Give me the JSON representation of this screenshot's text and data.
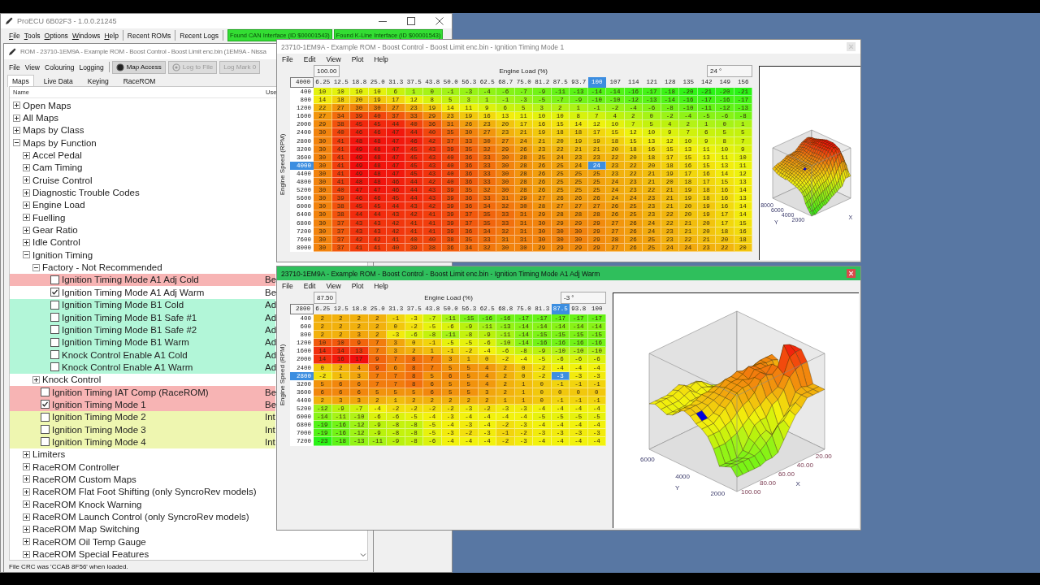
{
  "app_window": {
    "title": "ProECU 6B02F3 - 1.0.0.21245",
    "menu": [
      "File",
      "Tools",
      "Options",
      "Windows",
      "Help"
    ],
    "toolbar_buttons": [
      "Recent ROMs",
      "Recent Logs"
    ],
    "status_badges": [
      "Found CAN Interface (ID $00001543)",
      "Found K-Line Interface (ID $00001543)"
    ]
  },
  "rom_window": {
    "title": "ROM - 23710-1EM9A - Example ROM - Boost Control - Boost Limit enc.bin (1EM9A - Nissa",
    "menu": [
      "File",
      "View",
      "Colouring",
      "Logging"
    ],
    "toolbar_buttons": [
      {
        "label": "Map Access",
        "disabled": false
      },
      {
        "label": "Log to File",
        "disabled": true
      },
      {
        "label": "Log Mark 0",
        "disabled": true
      }
    ],
    "tabs": [
      {
        "label": "Maps",
        "selected": true
      },
      {
        "label": "Live Data",
        "selected": false
      },
      {
        "label": "Keying",
        "selected": false
      },
      {
        "label": "RaceROM",
        "selected": false
      }
    ],
    "tree": {
      "columns": [
        "Name",
        "Use"
      ],
      "items": [
        {
          "kind": "folder",
          "label": "Open Maps",
          "expanded": false
        },
        {
          "kind": "folder",
          "label": "All Maps",
          "expanded": false
        },
        {
          "kind": "folder",
          "label": "Maps by Class",
          "expanded": false
        },
        {
          "kind": "folder",
          "label": "Maps by Function",
          "expanded": true,
          "children": [
            {
              "kind": "folder",
              "label": "Accel Pedal",
              "expanded": false
            },
            {
              "kind": "folder",
              "label": "Cam Timing",
              "expanded": false
            },
            {
              "kind": "folder",
              "label": "Cruise Control",
              "expanded": false
            },
            {
              "kind": "folder",
              "label": "Diagnostic Trouble Codes",
              "expanded": false
            },
            {
              "kind": "folder",
              "label": "Engine Load",
              "expanded": false
            },
            {
              "kind": "folder",
              "label": "Fuelling",
              "expanded": false
            },
            {
              "kind": "folder",
              "label": "Gear Ratio",
              "expanded": false
            },
            {
              "kind": "folder",
              "label": "Idle Control",
              "expanded": false
            },
            {
              "kind": "folder",
              "label": "Ignition Timing",
              "expanded": true,
              "children": [
                {
                  "kind": "folder",
                  "label": "Factory - Not Recommended",
                  "expanded": true,
                  "children": [
                    {
                      "kind": "map",
                      "label": "Ignition Timing Mode A1 Adj Cold",
                      "checked": false,
                      "color": "#f7b4b4",
                      "user": "Be"
                    },
                    {
                      "kind": "map",
                      "label": "Ignition Timing Mode A1 Adj Warm",
                      "checked": true,
                      "user": "Be"
                    },
                    {
                      "kind": "map",
                      "label": "Ignition Timing Mode B1 Cold",
                      "checked": false,
                      "color": "#b2f6d8",
                      "user": "Ad"
                    },
                    {
                      "kind": "map",
                      "label": "Ignition Timing Mode B1 Safe #1",
                      "checked": false,
                      "color": "#b2f6d8",
                      "user": "Ad"
                    },
                    {
                      "kind": "map",
                      "label": "Ignition Timing Mode B1 Safe #2",
                      "checked": false,
                      "color": "#b2f6d8",
                      "user": "Ad"
                    },
                    {
                      "kind": "map",
                      "label": "Ignition Timing Mode B1 Warm",
                      "checked": false,
                      "color": "#b2f6d8",
                      "user": "Ad"
                    },
                    {
                      "kind": "map",
                      "label": "Knock Control Enable A1 Cold",
                      "checked": false,
                      "color": "#b2f6d8",
                      "user": "Ad"
                    },
                    {
                      "kind": "map",
                      "label": "Knock Control Enable A1 Warm",
                      "checked": false,
                      "color": "#b2f6d8",
                      "user": "Ad"
                    }
                  ]
                },
                {
                  "kind": "folder",
                  "label": "Knock Control",
                  "expanded": false
                },
                {
                  "kind": "map",
                  "label": "Ignition Timing IAT Comp (RaceROM)",
                  "checked": false,
                  "color": "#f7b4b4",
                  "user": "Be"
                },
                {
                  "kind": "map",
                  "label": "Ignition Timing Mode 1",
                  "checked": true,
                  "color": "#f7b4b4",
                  "user": "Be"
                },
                {
                  "kind": "map",
                  "label": "Ignition Timing Mode 2",
                  "checked": false,
                  "color": "#eef6b0",
                  "user": "Int"
                },
                {
                  "kind": "map",
                  "label": "Ignition Timing Mode 3",
                  "checked": false,
                  "color": "#eef6b0",
                  "user": "Int"
                },
                {
                  "kind": "map",
                  "label": "Ignition Timing Mode 4",
                  "checked": false,
                  "color": "#eef6b0",
                  "user": "Int"
                }
              ]
            },
            {
              "kind": "folder",
              "label": "Limiters",
              "expanded": false
            },
            {
              "kind": "folder",
              "label": "RaceROM Controller",
              "expanded": false
            },
            {
              "kind": "folder",
              "label": "RaceROM Custom Maps",
              "expanded": false
            },
            {
              "kind": "folder",
              "label": "RaceROM Flat Foot Shifting (only SyncroRev models)",
              "expanded": false
            },
            {
              "kind": "folder",
              "label": "RaceROM Knock Warning",
              "expanded": false
            },
            {
              "kind": "folder",
              "label": "RaceROM Launch Control (only SyncroRev models)",
              "expanded": false
            },
            {
              "kind": "folder",
              "label": "RaceROM Map Switching",
              "expanded": false
            },
            {
              "kind": "folder",
              "label": "RaceROM Oil Temp Gauge",
              "expanded": false
            },
            {
              "kind": "folder",
              "label": "RaceROM Special Features",
              "expanded": false
            }
          ]
        }
      ]
    },
    "status_bar": "File CRC was 'CCAB 8F56' when loaded."
  },
  "map_windows": [
    {
      "title": "23710-1EM9A - Example ROM - Boost Control - Boost Limit enc.bin - Ignition Timing Mode 1",
      "active": false,
      "menu": [
        "File",
        "Edit",
        "View",
        "Plot",
        "Help"
      ],
      "x_value": "100.00",
      "axis_title": "Engine Load (%)",
      "cell_value": "24 °",
      "corner": "4000",
      "y_axis_title": "Engine Speed (RPM)",
      "columns": [
        {
          "label": "6.25",
          "selected": false
        },
        {
          "label": "12.5",
          "selected": false
        },
        {
          "label": "18.8",
          "selected": false
        },
        {
          "label": "25.0",
          "selected": false
        },
        {
          "label": "31.3",
          "selected": false
        },
        {
          "label": "37.5",
          "selected": false
        },
        {
          "label": "43.8",
          "selected": false
        },
        {
          "label": "50.0",
          "selected": false
        },
        {
          "label": "56.3",
          "selected": false
        },
        {
          "label": "62.5",
          "selected": false
        },
        {
          "label": "68.7",
          "selected": false
        },
        {
          "label": "75.0",
          "selected": false
        },
        {
          "label": "81.2",
          "selected": false
        },
        {
          "label": "87.5",
          "selected": false
        },
        {
          "label": "93.7",
          "selected": false
        },
        {
          "label": "100",
          "selected": true
        },
        {
          "label": "107",
          "selected": false
        },
        {
          "label": "114",
          "selected": false
        },
        {
          "label": "121",
          "selected": false
        },
        {
          "label": "128",
          "selected": false
        },
        {
          "label": "135",
          "selected": false
        },
        {
          "label": "142",
          "selected": false
        },
        {
          "label": "149",
          "selected": false
        },
        {
          "label": "156",
          "selected": false
        }
      ],
      "rows": [
        {
          "label": "400",
          "selected": false,
          "cells": [
            "10",
            "10",
            "10",
            "10",
            "6",
            "1",
            "0",
            "-1",
            "-3",
            "-4",
            "-6",
            "-7",
            "-9",
            "-11",
            "-13",
            "-14",
            "-14",
            "-16",
            "-17",
            "-18",
            "-20",
            "-21",
            "-20",
            "-21"
          ]
        },
        {
          "label": "800",
          "selected": false,
          "cells": [
            "14",
            "18",
            "20",
            "19",
            "17",
            "12",
            "8",
            "5",
            "3",
            "1",
            "-1",
            "-3",
            "-5",
            "-7",
            "-9",
            "-10",
            "-10",
            "-12",
            "-13",
            "-14",
            "-16",
            "-17",
            "-16",
            "-17"
          ]
        },
        {
          "label": "1200",
          "selected": false,
          "cells": [
            "22",
            "27",
            "30",
            "30",
            "27",
            "23",
            "19",
            "14",
            "11",
            "9",
            "6",
            "5",
            "3",
            "2",
            "1",
            "-1",
            "-2",
            "-4",
            "-6",
            "-8",
            "-10",
            "-11",
            "-12",
            "-13"
          ]
        },
        {
          "label": "1600",
          "selected": false,
          "cells": [
            "27",
            "34",
            "39",
            "40",
            "37",
            "33",
            "29",
            "23",
            "19",
            "16",
            "13",
            "11",
            "10",
            "10",
            "8",
            "7",
            "4",
            "2",
            "0",
            "-2",
            "-4",
            "-5",
            "-6",
            "-8"
          ]
        },
        {
          "label": "2000",
          "selected": false,
          "cells": [
            "29",
            "38",
            "45",
            "45",
            "44",
            "40",
            "36",
            "31",
            "26",
            "23",
            "20",
            "17",
            "16",
            "15",
            "14",
            "12",
            "10",
            "7",
            "5",
            "4",
            "2",
            "1",
            "0",
            "1"
          ]
        },
        {
          "label": "2400",
          "selected": false,
          "cells": [
            "30",
            "40",
            "46",
            "46",
            "47",
            "44",
            "40",
            "35",
            "30",
            "27",
            "23",
            "21",
            "19",
            "18",
            "18",
            "17",
            "15",
            "12",
            "10",
            "9",
            "7",
            "6",
            "5",
            "5"
          ]
        },
        {
          "label": "2800",
          "selected": false,
          "cells": [
            "30",
            "41",
            "48",
            "48",
            "47",
            "46",
            "42",
            "37",
            "33",
            "30",
            "27",
            "24",
            "21",
            "20",
            "19",
            "19",
            "18",
            "15",
            "13",
            "12",
            "10",
            "9",
            "8",
            "7"
          ]
        },
        {
          "label": "3200",
          "selected": false,
          "cells": [
            "30",
            "41",
            "49",
            "48",
            "47",
            "45",
            "43",
            "39",
            "35",
            "32",
            "29",
            "26",
            "23",
            "22",
            "21",
            "21",
            "20",
            "18",
            "16",
            "15",
            "13",
            "11",
            "10",
            "9"
          ]
        },
        {
          "label": "3600",
          "selected": false,
          "cells": [
            "30",
            "41",
            "49",
            "48",
            "47",
            "45",
            "43",
            "40",
            "36",
            "33",
            "30",
            "28",
            "25",
            "24",
            "23",
            "23",
            "22",
            "20",
            "18",
            "17",
            "15",
            "13",
            "11",
            "10"
          ]
        },
        {
          "label": "4000",
          "selected": true,
          "cells": [
            "30",
            "41",
            "49",
            "48",
            "47",
            "45",
            "43",
            "40",
            "36",
            "33",
            "30",
            "28",
            "26",
            "25",
            "24",
            "24",
            "23",
            "22",
            "20",
            "18",
            "16",
            "15",
            "13",
            "11"
          ]
        },
        {
          "label": "4400",
          "selected": false,
          "cells": [
            "30",
            "41",
            "49",
            "48",
            "47",
            "45",
            "43",
            "40",
            "36",
            "33",
            "30",
            "28",
            "26",
            "25",
            "25",
            "25",
            "23",
            "22",
            "21",
            "19",
            "17",
            "16",
            "14",
            "12"
          ]
        },
        {
          "label": "4800",
          "selected": false,
          "cells": [
            "30",
            "41",
            "48",
            "48",
            "46",
            "44",
            "42",
            "40",
            "36",
            "33",
            "30",
            "28",
            "26",
            "25",
            "25",
            "25",
            "24",
            "23",
            "21",
            "20",
            "18",
            "17",
            "15",
            "13"
          ]
        },
        {
          "label": "5200",
          "selected": false,
          "cells": [
            "30",
            "40",
            "47",
            "47",
            "46",
            "44",
            "43",
            "39",
            "35",
            "32",
            "30",
            "28",
            "26",
            "25",
            "25",
            "25",
            "24",
            "23",
            "22",
            "21",
            "19",
            "18",
            "16",
            "14"
          ]
        },
        {
          "label": "5600",
          "selected": false,
          "cells": [
            "30",
            "39",
            "46",
            "46",
            "45",
            "44",
            "43",
            "39",
            "36",
            "33",
            "31",
            "29",
            "27",
            "26",
            "26",
            "26",
            "24",
            "24",
            "23",
            "21",
            "19",
            "18",
            "16",
            "13"
          ]
        },
        {
          "label": "6000",
          "selected": false,
          "cells": [
            "30",
            "38",
            "45",
            "45",
            "44",
            "43",
            "42",
            "39",
            "36",
            "34",
            "32",
            "30",
            "28",
            "27",
            "27",
            "27",
            "26",
            "25",
            "23",
            "21",
            "20",
            "19",
            "16",
            "14"
          ]
        },
        {
          "label": "6400",
          "selected": false,
          "cells": [
            "30",
            "38",
            "44",
            "44",
            "43",
            "42",
            "41",
            "39",
            "37",
            "35",
            "33",
            "31",
            "29",
            "28",
            "28",
            "28",
            "26",
            "25",
            "23",
            "22",
            "20",
            "19",
            "17",
            "14"
          ]
        },
        {
          "label": "6800",
          "selected": false,
          "cells": [
            "30",
            "37",
            "43",
            "43",
            "42",
            "41",
            "41",
            "39",
            "37",
            "35",
            "33",
            "31",
            "30",
            "29",
            "29",
            "29",
            "27",
            "26",
            "24",
            "22",
            "21",
            "20",
            "17",
            "15"
          ]
        },
        {
          "label": "7200",
          "selected": false,
          "cells": [
            "30",
            "37",
            "43",
            "43",
            "42",
            "41",
            "41",
            "39",
            "36",
            "34",
            "32",
            "31",
            "30",
            "30",
            "30",
            "29",
            "27",
            "26",
            "24",
            "23",
            "21",
            "20",
            "18",
            "16"
          ]
        },
        {
          "label": "7600",
          "selected": false,
          "cells": [
            "30",
            "37",
            "42",
            "42",
            "41",
            "40",
            "40",
            "38",
            "35",
            "33",
            "31",
            "31",
            "30",
            "30",
            "30",
            "29",
            "28",
            "26",
            "25",
            "23",
            "22",
            "21",
            "20",
            "18"
          ]
        },
        {
          "label": "8000",
          "selected": false,
          "cells": [
            "30",
            "37",
            "41",
            "41",
            "40",
            "39",
            "38",
            "36",
            "34",
            "32",
            "30",
            "30",
            "29",
            "29",
            "29",
            "29",
            "27",
            "26",
            "25",
            "24",
            "24",
            "23",
            "22",
            "20"
          ]
        }
      ],
      "plot": {
        "y_ticks": [
          "8000",
          "6000",
          "4000",
          "2000"
        ],
        "y_label": "Y",
        "x_label": "X"
      }
    },
    {
      "title": "23710-1EM9A - Example ROM - Boost Control - Boost Limit enc.bin - Ignition Timing Mode A1 Adj Warm",
      "active": true,
      "menu": [
        "File",
        "Edit",
        "View",
        "Plot",
        "Help"
      ],
      "x_value": "87.50",
      "axis_title": "Engine Load (%)",
      "cell_value": "-3 °",
      "corner": "2800",
      "y_axis_title": "Engine Speed (RPM)",
      "columns": [
        {
          "label": "6.25",
          "selected": false
        },
        {
          "label": "12.5",
          "selected": false
        },
        {
          "label": "18.8",
          "selected": false
        },
        {
          "label": "25.0",
          "selected": false
        },
        {
          "label": "31.3",
          "selected": false
        },
        {
          "label": "37.5",
          "selected": false
        },
        {
          "label": "43.8",
          "selected": false
        },
        {
          "label": "50.0",
          "selected": false
        },
        {
          "label": "56.3",
          "selected": false
        },
        {
          "label": "62.5",
          "selected": false
        },
        {
          "label": "68.8",
          "selected": false
        },
        {
          "label": "75.0",
          "selected": false
        },
        {
          "label": "81.3",
          "selected": false
        },
        {
          "label": "87.5",
          "selected": true
        },
        {
          "label": "93.8",
          "selected": false
        },
        {
          "label": "100",
          "selected": false
        }
      ],
      "rows": [
        {
          "label": "400",
          "selected": false,
          "cells": [
            "2",
            "2",
            "2",
            "2",
            "-1",
            "-3",
            "-7",
            "-11",
            "-15",
            "-16",
            "-16",
            "-17",
            "-17",
            "-17",
            "-17",
            "-17"
          ]
        },
        {
          "label": "600",
          "selected": false,
          "cells": [
            "2",
            "2",
            "2",
            "2",
            "0",
            "-2",
            "-5",
            "-6",
            "-9",
            "-11",
            "-13",
            "-14",
            "-14",
            "-14",
            "-14",
            "-14"
          ]
        },
        {
          "label": "800",
          "selected": false,
          "cells": [
            "2",
            "2",
            "3",
            "2",
            "-3",
            "-6",
            "-8",
            "-11",
            "-8",
            "-9",
            "-11",
            "-14",
            "-15",
            "-15",
            "-15",
            "-15"
          ]
        },
        {
          "label": "1200",
          "selected": false,
          "cells": [
            "10",
            "10",
            "9",
            "7",
            "3",
            "0",
            "-1",
            "-5",
            "-5",
            "-6",
            "-10",
            "-14",
            "-16",
            "-16",
            "-16",
            "-16"
          ]
        },
        {
          "label": "1600",
          "selected": false,
          "cells": [
            "14",
            "14",
            "13",
            "7",
            "3",
            "2",
            "1",
            "-1",
            "-2",
            "-4",
            "-6",
            "-8",
            "-9",
            "-10",
            "-10",
            "-10"
          ]
        },
        {
          "label": "2000",
          "selected": false,
          "cells": [
            "14",
            "16",
            "17",
            "9",
            "7",
            "8",
            "7",
            "3",
            "1",
            "0",
            "-2",
            "-4",
            "-5",
            "-6",
            "-6",
            "-6"
          ]
        },
        {
          "label": "2400",
          "selected": false,
          "cells": [
            "0",
            "2",
            "4",
            "9",
            "6",
            "8",
            "7",
            "5",
            "5",
            "4",
            "2",
            "0",
            "-2",
            "-4",
            "-4",
            "-4"
          ]
        },
        {
          "label": "2800",
          "selected": true,
          "cells": [
            "-2",
            "1",
            "3",
            "7",
            "7",
            "8",
            "5",
            "6",
            "5",
            "4",
            "2",
            "0",
            "-2",
            "-3",
            "-3",
            "-3"
          ]
        },
        {
          "label": "3200",
          "selected": false,
          "cells": [
            "5",
            "6",
            "6",
            "7",
            "7",
            "8",
            "6",
            "5",
            "5",
            "4",
            "2",
            "1",
            "0",
            "-1",
            "-1",
            "-1"
          ]
        },
        {
          "label": "3600",
          "selected": false,
          "cells": [
            "6",
            "6",
            "6",
            "5",
            "5",
            "5",
            "6",
            "5",
            "5",
            "3",
            "2",
            "1",
            "0",
            "0",
            "0",
            "0"
          ]
        },
        {
          "label": "4400",
          "selected": false,
          "cells": [
            "2",
            "3",
            "3",
            "2",
            "1",
            "2",
            "2",
            "2",
            "2",
            "2",
            "1",
            "1",
            "0",
            "-1",
            "-1",
            "-1"
          ]
        },
        {
          "label": "5200",
          "selected": false,
          "cells": [
            "-12",
            "-9",
            "-7",
            "-4",
            "-2",
            "-2",
            "-2",
            "-2",
            "-3",
            "-2",
            "-3",
            "-3",
            "-4",
            "-4",
            "-4",
            "-4"
          ]
        },
        {
          "label": "6000",
          "selected": false,
          "cells": [
            "-14",
            "-11",
            "-10",
            "-6",
            "-6",
            "-5",
            "-4",
            "-3",
            "-4",
            "-4",
            "-4",
            "-4",
            "-5",
            "-5",
            "-5",
            "-5"
          ]
        },
        {
          "label": "6800",
          "selected": false,
          "cells": [
            "-19",
            "-16",
            "-12",
            "-9",
            "-8",
            "-8",
            "-5",
            "-4",
            "-3",
            "-4",
            "-2",
            "-3",
            "-4",
            "-4",
            "-4",
            "-4"
          ]
        },
        {
          "label": "7000",
          "selected": false,
          "cells": [
            "-19",
            "-16",
            "-12",
            "-9",
            "-8",
            "-8",
            "-5",
            "-3",
            "-2",
            "-3",
            "-1",
            "-2",
            "-3",
            "-3",
            "-3",
            "-3"
          ]
        },
        {
          "label": "7200",
          "selected": false,
          "cells": [
            "-23",
            "-18",
            "-13",
            "-11",
            "-9",
            "-8",
            "-6",
            "-4",
            "-4",
            "-4",
            "-2",
            "-3",
            "-4",
            "-4",
            "-4",
            "-4"
          ]
        }
      ],
      "plot": {
        "y_ticks": [
          "6000",
          "4000",
          "2000"
        ],
        "y_label": "Y",
        "x_ticks": [
          "20.00",
          "40.00",
          "60.00",
          "80.00",
          "100.00"
        ],
        "x_label": "X"
      }
    }
  ]
}
